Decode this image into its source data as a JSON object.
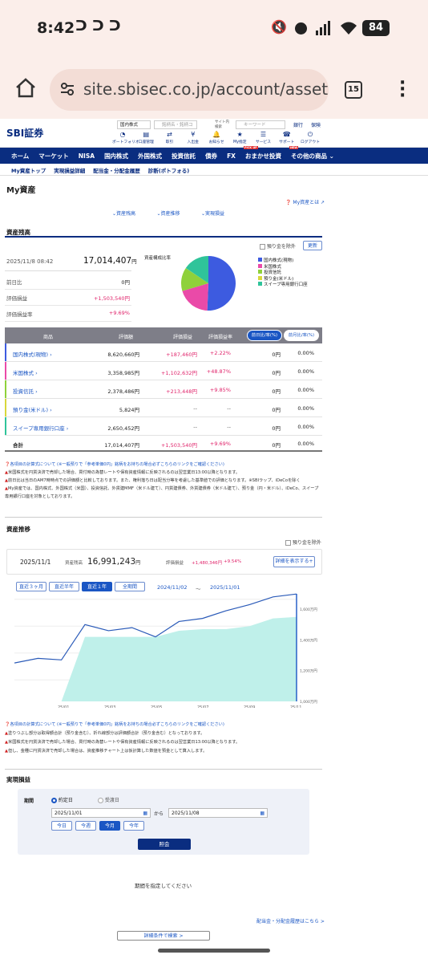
{
  "status": {
    "time": "8:42",
    "battery": "84"
  },
  "browser": {
    "url": "site.sbisec.co.jp/account/assets",
    "tabs": "15"
  },
  "header": {
    "logo": "SBI証券",
    "search_cat": "国内株式",
    "search_placeholder": "銘柄名・銘柄コ",
    "site_search": "サイト内検索",
    "keyword_placeholder": "キーワード",
    "bank": "銀行",
    "insurance": "保険",
    "icons": [
      {
        "label": "ポートフォリオ",
        "name": "portfolio"
      },
      {
        "label": "口座管理",
        "name": "account"
      },
      {
        "label": "取引",
        "name": "trade"
      },
      {
        "label": "入出金",
        "name": "deposit"
      },
      {
        "label": "お知らせ",
        "name": "notice"
      },
      {
        "label": "My指定",
        "name": "my"
      },
      {
        "label": "サービス",
        "name": "service"
      },
      {
        "label": "サポート",
        "name": "support"
      },
      {
        "label": "ログアウト",
        "name": "logout"
      }
    ]
  },
  "nav": {
    "items": [
      "ホーム",
      "マーケット",
      "NISA",
      "国内株式",
      "外国株式",
      "投資信託",
      "債券",
      "FX",
      "おまかせ投資",
      "その他の商品"
    ],
    "pickup": "PICK UP",
    "new": "NEW"
  },
  "subnav": {
    "items": [
      "My資産トップ",
      "実現損益詳細",
      "配当金・分配金履歴",
      "診断(ポトフォる)"
    ]
  },
  "page": {
    "title": "My資産",
    "help": "My資産とは",
    "anchors": [
      "資産残高",
      "資産推移",
      "実現損益"
    ]
  },
  "balance": {
    "title": "資産残高",
    "exclude": "預り金を除外",
    "refresh": "更新",
    "date": "2025/11/8 08:42",
    "total": "17,014,407",
    "yen": "円",
    "rows": [
      {
        "label": "前日比",
        "value": "0円"
      },
      {
        "label": "評価損益",
        "value": "+1,503,540円"
      },
      {
        "label": "評価損益率",
        "value": "+9.69%"
      }
    ],
    "pie_label": "資産構成比率",
    "legend": [
      "国内株式(現物)",
      "米国株式",
      "投資信託",
      "預り金(米ドル)",
      "スイープ専用銀行口座"
    ]
  },
  "holdings": {
    "headers": [
      "商品",
      "評価額",
      "評価損益",
      "評価損益率",
      "前日比/率(%)",
      "前月比/率(%)"
    ],
    "rows": [
      {
        "name": "国内株式(現物)",
        "value": "8,620,660円",
        "pl": "+187,460円",
        "rate": "+2.22%",
        "d": "0円",
        "dp": "0.00%",
        "color": "#3d5be0"
      },
      {
        "name": "米国株式",
        "value": "3,358,985円",
        "pl": "+1,102,632円",
        "rate": "+48.87%",
        "d": "0円",
        "dp": "0.00%",
        "color": "#ea4aa8"
      },
      {
        "name": "投資信託",
        "value": "2,378,486円",
        "pl": "+213,448円",
        "rate": "+9.85%",
        "d": "0円",
        "dp": "0.00%",
        "color": "#8fd13b"
      },
      {
        "name": "預り金(米ドル)",
        "value": "5,824円",
        "pl": "--",
        "rate": "--",
        "d": "0円",
        "dp": "0.00%",
        "color": "#d8d83a"
      },
      {
        "name": "スイープ専用銀行口座",
        "value": "2,650,452円",
        "pl": "--",
        "rate": "--",
        "d": "0円",
        "dp": "0.00%",
        "color": "#2fc49a"
      }
    ],
    "total": {
      "name": "合計",
      "value": "17,014,407円",
      "pl": "+1,503,540円",
      "rate": "+9.69%",
      "d": "0円",
      "dp": "0.00%"
    }
  },
  "notes1": [
    "各項目の計算式について (※一般預りで「参考単価0円」銘柄をお持ちの場合必ずこちらのリンクをご確認ください)",
    "米国株式を円貨決済で売却した場合、買付時の為替レートや保有資産情報に反映されるのは翌営業日13:00以降となります。",
    "前日比は当日のAM7時時点での評価額と比較しております。また、権利落ち日は配当分等を考慮した基準値での評価となります。※SBIラップ、iDeCoを除く",
    "My資産では、国内株式、外国株式（米国）、投資信託、外貨建MMF（米ドル建て）、円貨建債券、外貨建債券（米ドル建て）、預り金（円・米ドル）、iDeCo、スイープ専用銀行口座を対象としております。"
  ],
  "trend": {
    "title": "資産推移",
    "exclude": "預り金を除外",
    "date": "2025/11/1",
    "label": "資産残高",
    "total": "16,991,243",
    "yen": "円",
    "pl_label": "評価損益",
    "pl": "+1,480,346円",
    "rate": "+9.54%",
    "detail": "詳細を表示する+",
    "ranges": [
      "直近３ヶ月",
      "直近半年",
      "直近１年",
      "全期間"
    ],
    "from": "2024/11/02",
    "tilde": "〜",
    "to": "2025/11/01"
  },
  "chart_data": {
    "type": "area",
    "x": [
      "2024-11",
      "2024-12",
      "2025-01",
      "2025-02",
      "2025-03",
      "2025-04",
      "2025-05",
      "2025-06",
      "2025-07",
      "2025-08",
      "2025-09",
      "2025-10",
      "2025-11"
    ],
    "series": [
      {
        "values": [
          12.5,
          12.8,
          12.7,
          15.0,
          14.6,
          14.8,
          14.2,
          15.2,
          15.4,
          15.9,
          16.3,
          16.8,
          16.99
        ]
      },
      {
        "values": [
          10.0,
          10.0,
          10.0,
          14.2,
          14.2,
          14.2,
          14.2,
          14.6,
          14.7,
          14.7,
          14.9,
          15.4,
          15.5
        ]
      }
    ],
    "xlabels": [
      "25/01",
      "25/03",
      "25/05",
      "25/07",
      "25/09",
      "25/11"
    ],
    "ylabels": [
      "1,600万円",
      "1,400万円",
      "1,200万円",
      "1,000万円"
    ],
    "ylim": [
      10,
      17
    ],
    "grid": true
  },
  "notes2": [
    "各項目の計算式について (※一般預りで「参考単価0円」銘柄をお持ちの場合必ずこちらのリンクをご確認ください)",
    "塗りつぶし部分は取得額合計（預り金含む）、折れ線部分は評価額合計（預り金含む）となっております。",
    "米国株式を円貨決済で売却した場合、買付時の為替レートや保有資産情報に反映されるのは翌営業日13:00以降となります。",
    "但し、金種に円貨決済で売却した場合は、資産推移チャート上は仮計算した数値を預金として算入します。"
  ],
  "realized": {
    "title": "実現損益",
    "period": "期間",
    "opt1": "約定日",
    "opt2": "受渡日",
    "from": "2025/11/01",
    "kara": "から",
    "to": "2025/11/08",
    "quick": [
      "今日",
      "今週",
      "今月",
      "今年"
    ],
    "search": "照会",
    "msg": "期間を指定してください",
    "link": "配当金・分配金履歴はこちら >",
    "bottom": "詳細条件で検索 >"
  }
}
